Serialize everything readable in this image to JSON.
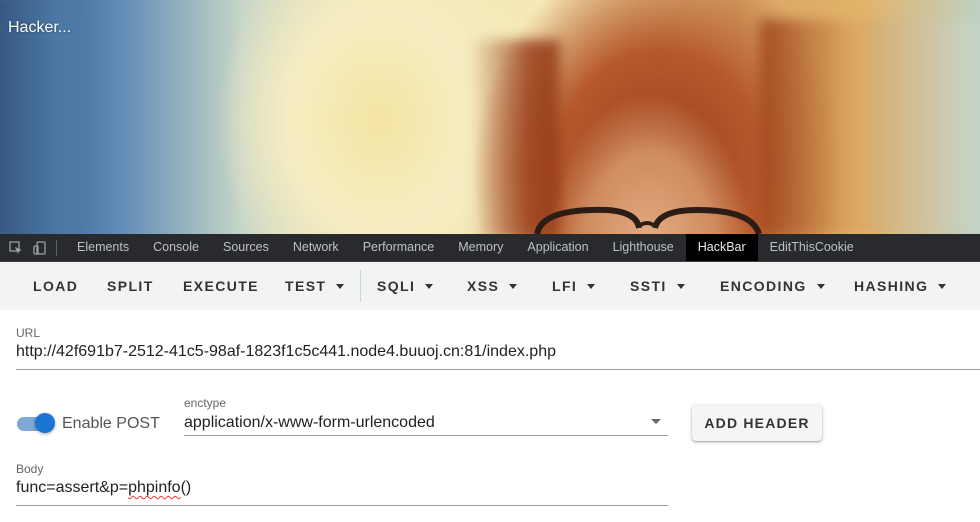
{
  "page": {
    "title": "Hacker..."
  },
  "devtools": {
    "tabs": [
      "Elements",
      "Console",
      "Sources",
      "Network",
      "Performance",
      "Memory",
      "Application",
      "Lighthouse",
      "HackBar",
      "EditThisCookie"
    ],
    "active_tab": "HackBar",
    "icons": [
      "inspect-element-icon",
      "device-toggle-icon"
    ]
  },
  "hackbar": {
    "buttons": {
      "load": "LOAD",
      "split": "SPLIT",
      "execute": "EXECUTE",
      "test": "TEST",
      "sqli": "SQLI",
      "xss": "XSS",
      "lfi": "LFI",
      "ssti": "SSTI",
      "encoding": "ENCODING",
      "hashing": "HASHING"
    },
    "url": {
      "label": "URL",
      "value": "http://42f691b7-2512-41c5-98af-1823f1c5c441.node4.buuoj.cn:81/index.php"
    },
    "post": {
      "label": "Enable POST",
      "enabled": true
    },
    "enctype": {
      "label": "enctype",
      "value": "application/x-www-form-urlencoded"
    },
    "add_header": "ADD HEADER",
    "body": {
      "label": "Body",
      "prefix": "func=assert&p=",
      "misspelled": "phpinfo",
      "suffix": "()"
    }
  },
  "colors": {
    "devtools_bg": "#292a2d",
    "toolbar_bg": "#f1f3f4",
    "accent": "#1976d2"
  }
}
